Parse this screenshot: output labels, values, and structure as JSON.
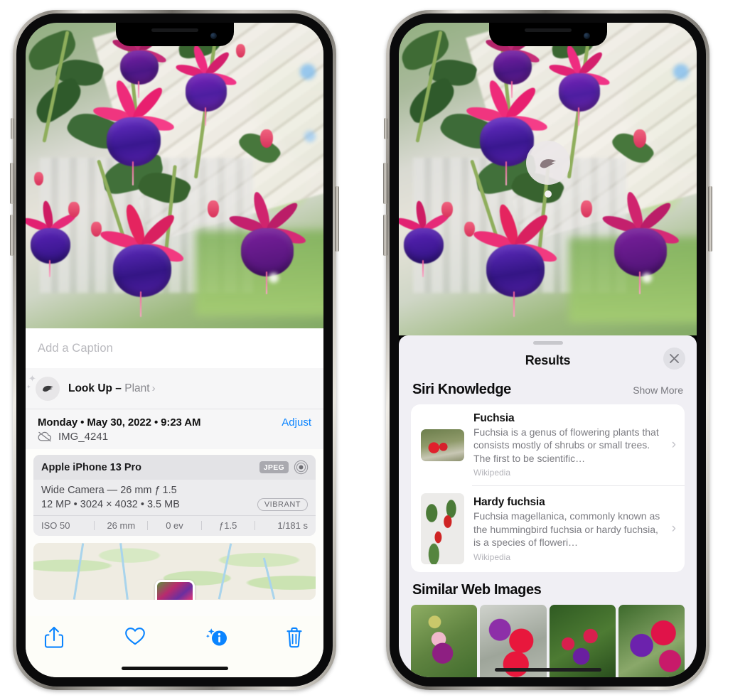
{
  "left_phone": {
    "caption_placeholder": "Add a Caption",
    "lookup": {
      "label": "Look Up – ",
      "subject": "Plant",
      "chevron": "›",
      "icon": "leaf-icon"
    },
    "meta": {
      "date": "Monday • May 30, 2022 • 9:23 AM",
      "adjust_label": "Adjust",
      "filename": "IMG_4241",
      "cloud_icon": "icloud-slash-icon"
    },
    "camera_card": {
      "device": "Apple iPhone 13 Pro",
      "format_badge": "JPEG",
      "aperture_icon": "aperture-icon",
      "lens": "Wide Camera — 26 mm ƒ 1.5",
      "resolution": "12 MP • 3024 × 4032 • 3.5 MB",
      "style_badge": "VIBRANT",
      "exif": [
        "ISO 50",
        "26 mm",
        "0 ev",
        "ƒ1.5",
        "1/181 s"
      ]
    },
    "toolbar": [
      {
        "name": "share-button",
        "icon": "share-icon"
      },
      {
        "name": "favorite-button",
        "icon": "heart-icon"
      },
      {
        "name": "info-button",
        "icon": "info-sparkle-icon"
      },
      {
        "name": "delete-button",
        "icon": "trash-icon"
      }
    ],
    "accent_color": "#0a84ff"
  },
  "right_phone": {
    "lookup_pop_icon": "leaf-icon",
    "sheet": {
      "title": "Results",
      "close_icon": "close-icon",
      "sections": [
        {
          "title": "Siri Knowledge",
          "action": "Show More",
          "items": [
            {
              "title": "Fuchsia",
              "description": "Fuchsia is a genus of flowering plants that consists mostly of shrubs or small trees. The first to be scientific…",
              "source": "Wikipedia",
              "chevron": "›"
            },
            {
              "title": "Hardy fuchsia",
              "description": "Fuchsia magellanica, commonly known as the hummingbird fuchsia or hardy fuchsia, is a species of floweri…",
              "source": "Wikipedia",
              "chevron": "›"
            }
          ]
        },
        {
          "title": "Similar Web Images",
          "images": [
            "web-image-1",
            "web-image-2",
            "web-image-3",
            "web-image-4"
          ]
        }
      ]
    }
  }
}
